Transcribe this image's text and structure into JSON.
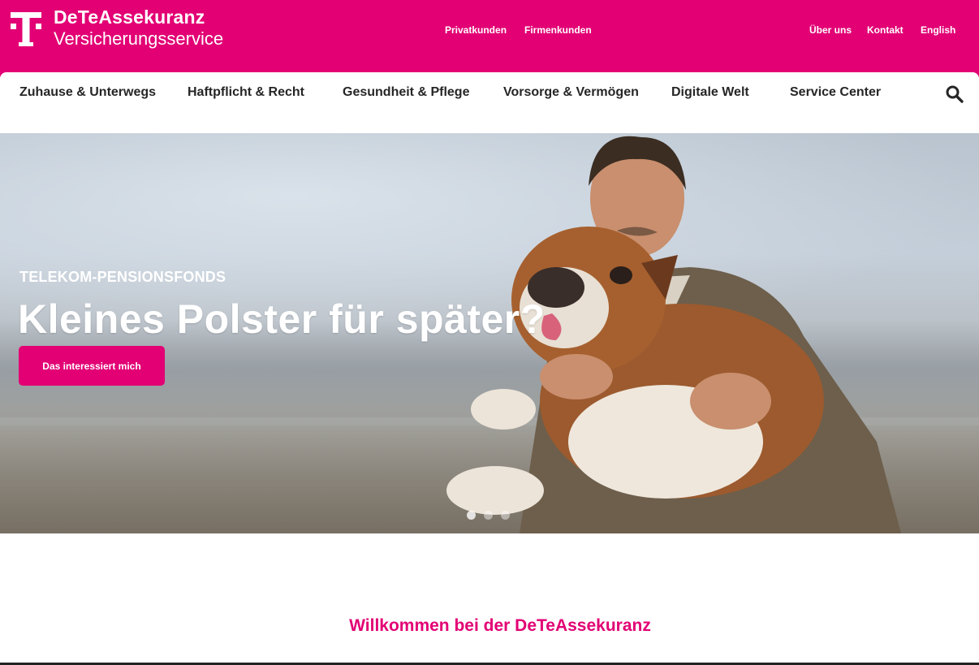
{
  "colors": {
    "brand_magenta": "#e20074",
    "nav_text": "#262626",
    "white": "#ffffff"
  },
  "header": {
    "logo_icon": "telekom-t-logo",
    "brand_name": "DeTeAssekuranz",
    "brand_subtitle": "Versicherungsservice",
    "segment_links": [
      "Privatkunden",
      "Firmenkunden"
    ],
    "utility_links": [
      "Über uns",
      "Kontakt",
      "English"
    ]
  },
  "nav": {
    "items": [
      "Zuhause & Unterwegs",
      "Haftpflicht & Recht",
      "Gesundheit & Pflege",
      "Vorsorge & Vermögen",
      "Digitale Welt",
      "Service Center"
    ],
    "search_icon": "search-icon"
  },
  "hero": {
    "eyebrow": "TELEKOM-PENSIONSFONDS",
    "headline": "Kleines Polster für später?",
    "cta_label": "Das interessiert mich",
    "image": "man-holding-bulldog-photo",
    "slides_total": 3,
    "active_slide": 1
  },
  "welcome": {
    "title": "Willkommen bei der DeTeAssekuranz"
  }
}
